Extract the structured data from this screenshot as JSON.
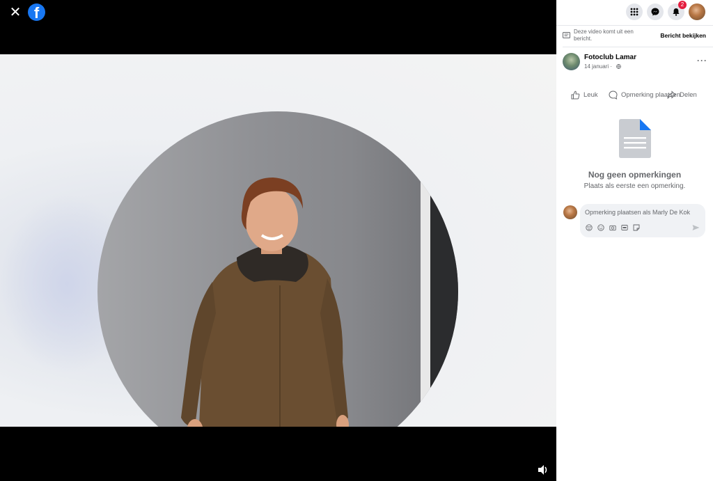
{
  "viewer": {
    "close_icon": "close-icon",
    "logo_letter": "f",
    "mute_icon": "volume-icon"
  },
  "topbar": {
    "menu_icon": "grid-menu-icon",
    "messenger_icon": "messenger-icon",
    "notifications_icon": "bell-icon",
    "notification_count": "2"
  },
  "message_banner": {
    "text": "Deze video komt uit een bericht.",
    "link": "Bericht bekijken"
  },
  "post": {
    "author": "Fotoclub Lamar",
    "date": "14 januari",
    "separator": "·",
    "more": "···"
  },
  "actions": {
    "like": "Leuk",
    "comment": "Opmerking plaatsen",
    "share": "Delen"
  },
  "comments": {
    "empty_title": "Nog geen opmerkingen",
    "empty_subtitle": "Plaats als eerste een opmerking.",
    "placeholder": "Opmerking plaatsen als Marly De Kok"
  },
  "colors": {
    "brand": "#1877f2",
    "badge": "#e41e3f",
    "text_secondary": "#65676b"
  }
}
